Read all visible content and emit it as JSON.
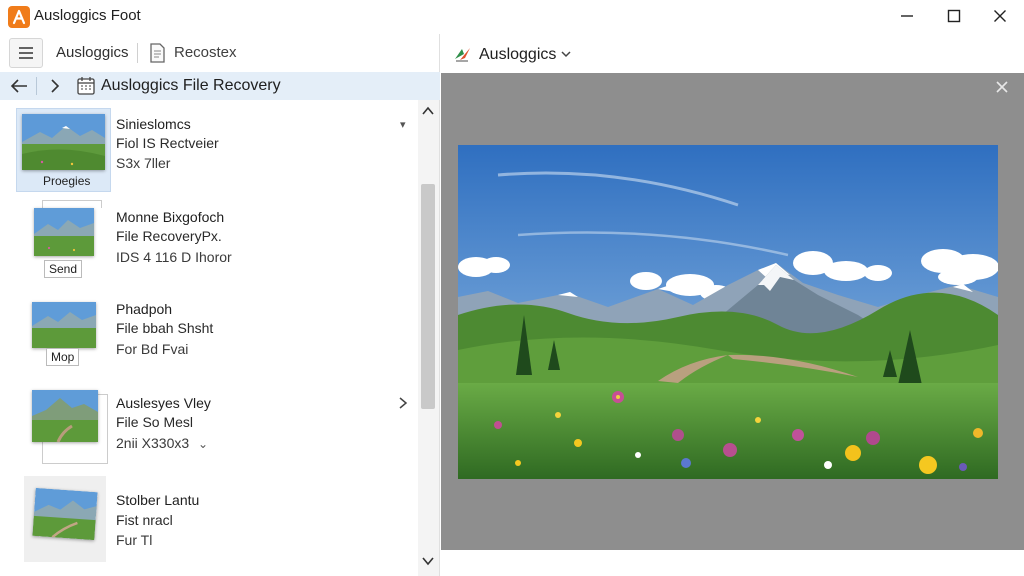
{
  "window": {
    "title": "Ausloggics Foot"
  },
  "left": {
    "tab_a": "Ausloggics",
    "tab_b": "Recostex",
    "nav_title": "Ausloggics  File Recovery"
  },
  "items": [
    {
      "line1": "Sinieslomcs",
      "line2": "Fiol IS Rectveier",
      "line3": "S3x 7ller",
      "thumb_label": "Proegies"
    },
    {
      "line1": "Monne Bixgofoch",
      "line2": "File RecoveryPx.",
      "line3": "IDS 4 116 D Ihoror",
      "thumb_label": "Send"
    },
    {
      "line1": "Phadpoh",
      "line2": "File bbah Shsht",
      "line3": "For Bd Fvai",
      "thumb_label": "Mop"
    },
    {
      "line1": "Auslesyes Vley",
      "line2": "File So Mesl",
      "line3": "2nii X330x3"
    },
    {
      "line1": "Stolber Lantu",
      "line2": "Fist nracl",
      "line3": "Fur Tl"
    }
  ],
  "right": {
    "title": "Ausloggics"
  },
  "colors": {
    "accent_orange": "#f07c1a",
    "nav_highlight": "#e4eef8",
    "preview_bg": "#8e8e8e"
  },
  "icons": {
    "app": "app-logo-icon",
    "menu": "hamburger-menu-icon",
    "back": "arrow-left-icon",
    "forward": "chevron-right-icon",
    "close": "close-icon"
  }
}
